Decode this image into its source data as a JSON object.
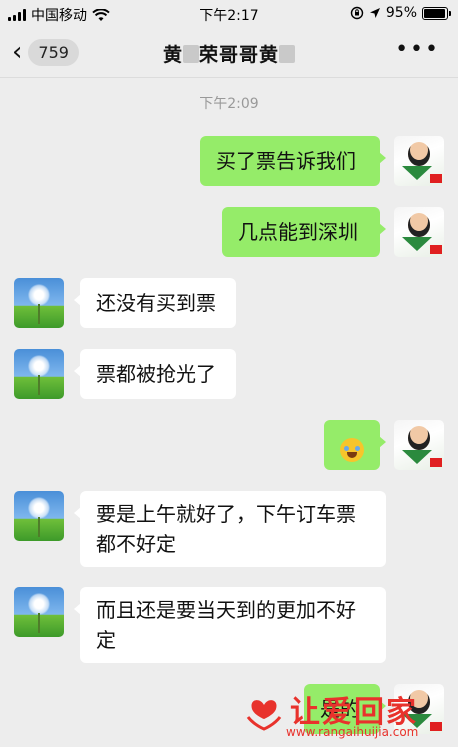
{
  "status_bar": {
    "carrier": "中国移动",
    "time": "下午2:17",
    "battery_text": "95%",
    "battery_level": 0.95
  },
  "nav": {
    "back_badge": "759",
    "title_part1": "黄",
    "title_part2": "荣哥哥黄",
    "more_label": "•••"
  },
  "chat": {
    "timestamp": "下午2:09",
    "messages": [
      {
        "sender": "me",
        "text": "买了票告诉我们"
      },
      {
        "sender": "me",
        "text": "几点能到深圳"
      },
      {
        "sender": "friend",
        "text": "还没有买到票"
      },
      {
        "sender": "friend",
        "text": "票都被抢光了"
      },
      {
        "sender": "me",
        "text": "",
        "emoji": "rolling-on-floor-laughing-emoji"
      },
      {
        "sender": "friend",
        "text": "要是上午就好了，下午订车票都不好定"
      },
      {
        "sender": "friend",
        "text": "而且还是要当天到的更加不好定"
      },
      {
        "sender": "me",
        "text": "是的"
      }
    ]
  },
  "watermark": {
    "title": "让爱回家",
    "url": "www.rangaihuijia.com",
    "color": "#e8322c"
  },
  "colors": {
    "background": "#ededed",
    "mine_bubble": "#95ec69",
    "their_bubble": "#ffffff"
  }
}
